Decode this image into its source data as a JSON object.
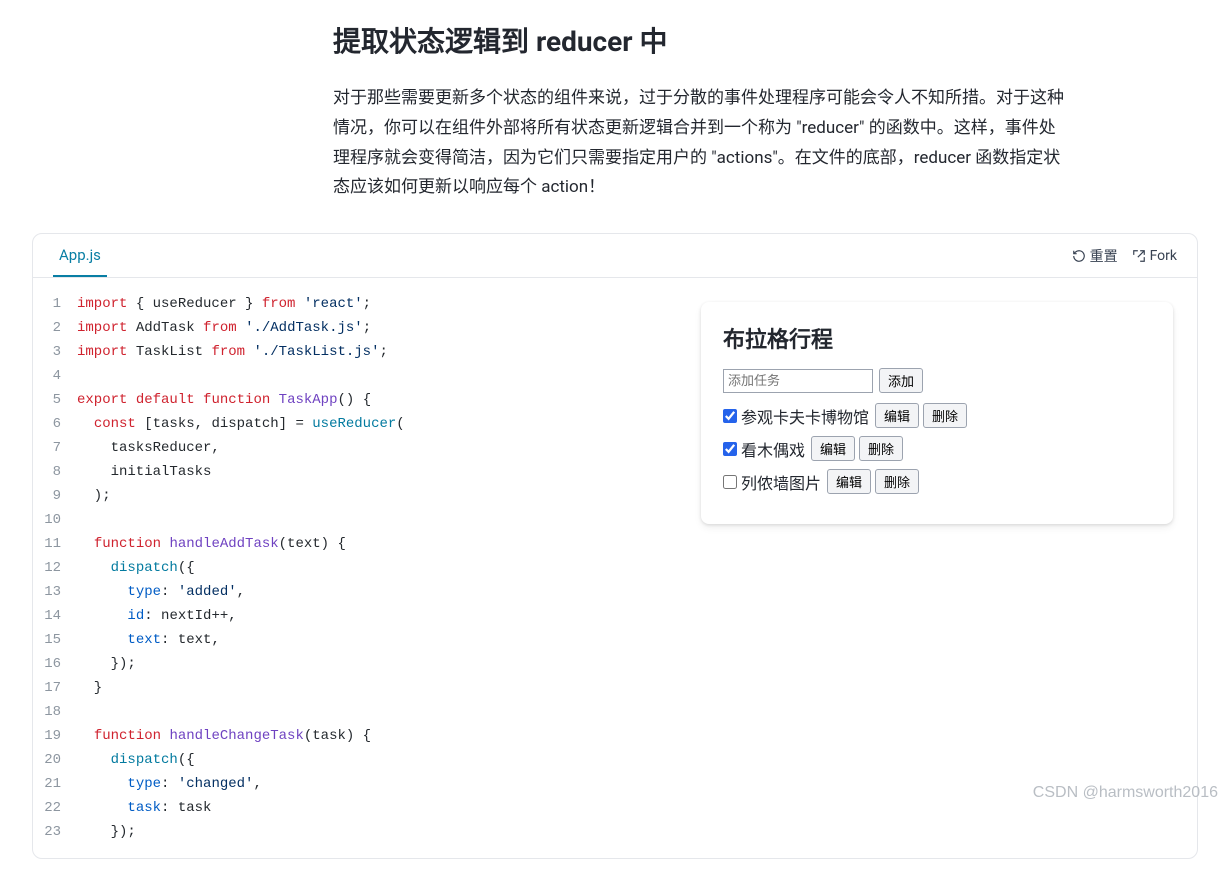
{
  "article": {
    "heading": "提取状态逻辑到 reducer 中",
    "paragraph": "对于那些需要更新多个状态的组件来说，过于分散的事件处理程序可能会令人不知所措。对于这种情况，你可以在组件外部将所有状态更新逻辑合并到一个称为 \"reducer\" 的函数中。这样，事件处理程序就会变得简洁，因为它们只需要指定用户的 \"actions\"。在文件的底部，reducer 函数指定状态应该如何更新以响应每个 action！"
  },
  "tabs": {
    "file": "App.js"
  },
  "actions": {
    "reset": "重置",
    "fork": "Fork"
  },
  "code": [
    {
      "n": 1,
      "html": "<span class='tk'>import</span> { useReducer } <span class='tk'>from</span> <span class='tk3'>'react'</span>;"
    },
    {
      "n": 2,
      "html": "<span class='tk'>import</span> AddTask <span class='tk'>from</span> <span class='tk3'>'./AddTask.js'</span>;"
    },
    {
      "n": 3,
      "html": "<span class='tk'>import</span> TaskList <span class='tk'>from</span> <span class='tk3'>'./TaskList.js'</span>;"
    },
    {
      "n": 4,
      "html": ""
    },
    {
      "n": 5,
      "html": "<span class='tk'>export</span> <span class='tk'>default</span> <span class='tk'>function</span> <span class='tk4'>TaskApp</span>() {"
    },
    {
      "n": 6,
      "html": "  <span class='tk'>const</span> [tasks, dispatch] = <span class='tk5'>useReducer</span>("
    },
    {
      "n": 7,
      "html": "    tasksReducer,"
    },
    {
      "n": 8,
      "html": "    initialTasks"
    },
    {
      "n": 9,
      "html": "  );"
    },
    {
      "n": 10,
      "html": ""
    },
    {
      "n": 11,
      "html": "  <span class='tk'>function</span> <span class='tk4'>handleAddTask</span>(text) {"
    },
    {
      "n": 12,
      "html": "    <span class='tk5'>dispatch</span>({"
    },
    {
      "n": 13,
      "html": "      <span class='tk2'>type</span>: <span class='tk3'>'added'</span>,"
    },
    {
      "n": 14,
      "html": "      <span class='tk2'>id</span>: nextId++,"
    },
    {
      "n": 15,
      "html": "      <span class='tk2'>text</span>: text,"
    },
    {
      "n": 16,
      "html": "    });"
    },
    {
      "n": 17,
      "html": "  }"
    },
    {
      "n": 18,
      "html": ""
    },
    {
      "n": 19,
      "html": "  <span class='tk'>function</span> <span class='tk4'>handleChangeTask</span>(task) {"
    },
    {
      "n": 20,
      "html": "    <span class='tk5'>dispatch</span>({"
    },
    {
      "n": 21,
      "html": "      <span class='tk2'>type</span>: <span class='tk3'>'changed'</span>,"
    },
    {
      "n": 22,
      "html": "      <span class='tk2'>task</span>: task"
    },
    {
      "n": 23,
      "html": "    });"
    }
  ],
  "preview": {
    "title": "布拉格行程",
    "placeholder": "添加任务",
    "add": "添加",
    "edit": "编辑",
    "delete": "删除",
    "tasks": [
      {
        "label": "参观卡夫卡博物馆",
        "checked": true
      },
      {
        "label": "看木偶戏",
        "checked": true
      },
      {
        "label": "列侬墙图片",
        "checked": false
      }
    ]
  },
  "watermark": "CSDN @harmsworth2016"
}
